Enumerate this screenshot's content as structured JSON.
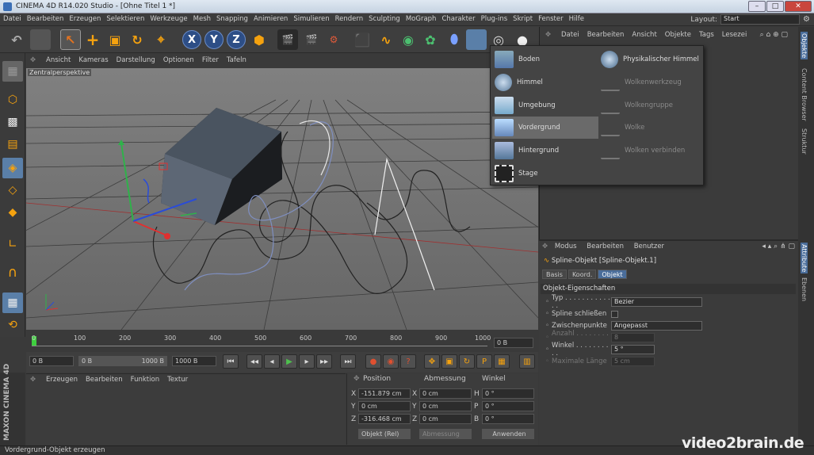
{
  "window": {
    "title": "CINEMA 4D R14.020 Studio - [Ohne Titel 1 *]",
    "minimize": "–",
    "maximize": "□",
    "close": "✕"
  },
  "menubar": {
    "items": [
      "Datei",
      "Bearbeiten",
      "Erzeugen",
      "Selektieren",
      "Werkzeuge",
      "Mesh",
      "Snapping",
      "Animieren",
      "Simulieren",
      "Rendern",
      "Sculpting",
      "MoGraph",
      "Charakter",
      "Plug-ins",
      "Skript",
      "Fenster",
      "Hilfe"
    ],
    "layout_label": "Layout:",
    "layout_value": "Start"
  },
  "toolbar": {
    "x": "X",
    "y": "Y",
    "z": "Z"
  },
  "viewport": {
    "menu": [
      "Ansicht",
      "Kameras",
      "Darstellung",
      "Optionen",
      "Filter",
      "Tafeln"
    ],
    "label": "Zentralperspektive"
  },
  "timeline": {
    "ticks": [
      "0",
      "100",
      "200",
      "300",
      "400",
      "500",
      "600",
      "700",
      "800",
      "900",
      "1000"
    ],
    "frame_field": "0 B"
  },
  "transport": {
    "start_field": "0 B",
    "range_start": "0 B",
    "range_end": "1000 B",
    "end_field": "1000 B"
  },
  "material_panel": {
    "menu": [
      "Erzeugen",
      "Bearbeiten",
      "Funktion",
      "Textur"
    ]
  },
  "coord_panel": {
    "headers": [
      "Position",
      "Abmessung",
      "Winkel"
    ],
    "rows": [
      {
        "axis": "X",
        "pos": "-151.879 cm",
        "size_axis": "X",
        "size": "0 cm",
        "rot_axis": "H",
        "rot": "0 °"
      },
      {
        "axis": "Y",
        "pos": "0 cm",
        "size_axis": "Y",
        "size": "0 cm",
        "rot_axis": "P",
        "rot": "0 °"
      },
      {
        "axis": "Z",
        "pos": "-316.468 cm",
        "size_axis": "Z",
        "size": "0 cm",
        "rot_axis": "B",
        "rot": "0 °"
      }
    ],
    "mode_select": "Objekt (Rel)",
    "size_select": "Abmessung",
    "apply": "Anwenden"
  },
  "object_manager": {
    "menu": [
      "Datei",
      "Bearbeiten",
      "Ansicht",
      "Objekte",
      "Tags",
      "Lesezei"
    ]
  },
  "dropdown": {
    "left": [
      {
        "label": "Boden",
        "enabled": true,
        "highlight": false,
        "icon": "floor-icon"
      },
      {
        "label": "Himmel",
        "enabled": true,
        "highlight": false,
        "icon": "sky-icon"
      },
      {
        "label": "Umgebung",
        "enabled": true,
        "highlight": false,
        "icon": "environment-icon"
      },
      {
        "label": "Vordergrund",
        "enabled": true,
        "highlight": true,
        "icon": "foreground-icon"
      },
      {
        "label": "Hintergrund",
        "enabled": true,
        "highlight": false,
        "icon": "background-icon"
      },
      {
        "label": "Stage",
        "enabled": true,
        "highlight": false,
        "icon": "stage-icon"
      }
    ],
    "right": [
      {
        "label": "Physikalischer Himmel",
        "enabled": true,
        "icon": "physical-sky-icon"
      },
      {
        "label": "Wolkenwerkzeug",
        "enabled": false,
        "icon": "cloud-tool-icon"
      },
      {
        "label": "Wolkengruppe",
        "enabled": false,
        "icon": "cloud-group-icon"
      },
      {
        "label": "Wolke",
        "enabled": false,
        "icon": "cloud-icon"
      },
      {
        "label": "Wolken verbinden",
        "enabled": false,
        "icon": "cloud-connect-icon"
      }
    ]
  },
  "attributes": {
    "menu": [
      "Modus",
      "Bearbeiten",
      "Benutzer"
    ],
    "object_title": "Spline-Objekt [Spline-Objekt.1]",
    "tabs": [
      {
        "label": "Basis",
        "active": false
      },
      {
        "label": "Koord.",
        "active": false
      },
      {
        "label": "Objekt",
        "active": true
      }
    ],
    "section": "Objekt-Eigenschaften",
    "rows": [
      {
        "label": "Typ . . . . . . . . . . . . .",
        "kind": "select",
        "value": "Bezier",
        "enabled": true
      },
      {
        "label": "Spline schließen",
        "kind": "check",
        "value": "",
        "enabled": true
      },
      {
        "label": "Zwischenpunkte",
        "kind": "select",
        "value": "Angepasst",
        "enabled": true
      },
      {
        "label": "Anzahl . . . . . . . . . .",
        "kind": "num",
        "value": "8",
        "enabled": false
      },
      {
        "label": "Winkel . . . . . . . . . .",
        "kind": "num",
        "value": "5 °",
        "enabled": true
      },
      {
        "label": "Maximale Länge",
        "kind": "num",
        "value": "5 cm",
        "enabled": false
      }
    ]
  },
  "side_tabs": [
    "Objekte",
    "Content Browser",
    "Struktur",
    "Attribute",
    "Ebenen"
  ],
  "status": "Vordergrund-Objekt erzeugen",
  "maxon": "MAXON CINEMA 4D",
  "watermark": "video2brain.de",
  "colors": {
    "accent": "#4a6d9a",
    "highlight": "#6a6a6a",
    "viewport": "#6d6d6d"
  }
}
